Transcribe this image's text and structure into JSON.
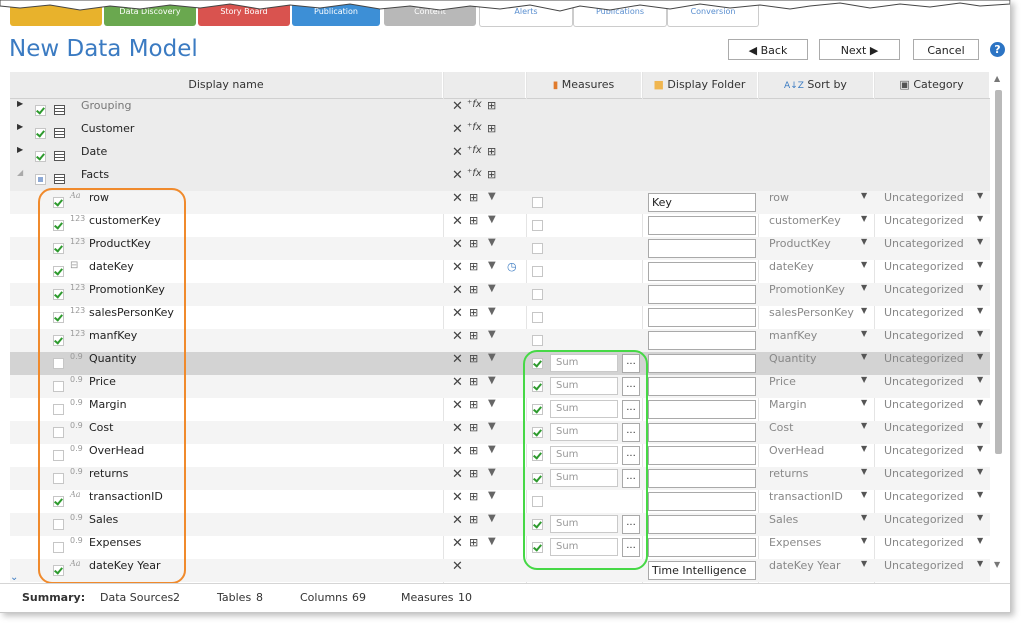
{
  "window": {
    "title": "New Data Model",
    "tabs": [
      "",
      "Data Discovery",
      "Story Board",
      "Publication",
      "Content",
      "Alerts",
      "Publications",
      "Conversion"
    ],
    "buttons": {
      "back": "Back",
      "next": "Next",
      "cancel": "Cancel",
      "help": "?"
    }
  },
  "columns": {
    "display_name": "Display name",
    "measures": "Measures",
    "display_folder": "Display Folder",
    "sort_by": "Sort by",
    "category": "Category"
  },
  "groups": [
    {
      "name": "Grouping",
      "checked": true
    },
    {
      "name": "Customer",
      "checked": true
    },
    {
      "name": "Date",
      "checked": true
    },
    {
      "name": "Facts",
      "checked": "partial"
    }
  ],
  "fields": [
    {
      "name": "row",
      "type": "Aa",
      "checked": true,
      "measure": false,
      "measure_box": true,
      "folder": "Key",
      "sort_by": "row",
      "category": "Uncategorized"
    },
    {
      "name": "customerKey",
      "type": "123",
      "checked": true,
      "measure": false,
      "measure_box": true,
      "folder": "",
      "sort_by": "customerKey",
      "category": "Uncategorized"
    },
    {
      "name": "ProductKey",
      "type": "123",
      "checked": true,
      "measure": false,
      "measure_box": true,
      "folder": "",
      "sort_by": "ProductKey",
      "category": "Uncategorized"
    },
    {
      "name": "dateKey",
      "type": "date",
      "checked": true,
      "measure": false,
      "measure_box": true,
      "folder": "",
      "sort_by": "dateKey",
      "category": "Uncategorized"
    },
    {
      "name": "PromotionKey",
      "type": "123",
      "checked": true,
      "measure": false,
      "measure_box": true,
      "folder": "",
      "sort_by": "PromotionKey",
      "category": "Uncategorized"
    },
    {
      "name": "salesPersonKey",
      "type": "123",
      "checked": true,
      "measure": false,
      "measure_box": true,
      "folder": "",
      "sort_by": "salesPersonKey",
      "category": "Uncategorized"
    },
    {
      "name": "manfKey",
      "type": "123",
      "checked": true,
      "measure": false,
      "measure_box": true,
      "folder": "",
      "sort_by": "manfKey",
      "category": "Uncategorized"
    },
    {
      "name": "Quantity",
      "type": "0.9",
      "checked": false,
      "measure": true,
      "agg": "Sum",
      "folder": "",
      "sort_by": "Quantity",
      "category": "Uncategorized",
      "selected": true
    },
    {
      "name": "Price",
      "type": "0.9",
      "checked": false,
      "measure": true,
      "agg": "Sum",
      "folder": "",
      "sort_by": "Price",
      "category": "Uncategorized"
    },
    {
      "name": "Margin",
      "type": "0.9",
      "checked": false,
      "measure": true,
      "agg": "Sum",
      "folder": "",
      "sort_by": "Margin",
      "category": "Uncategorized"
    },
    {
      "name": "Cost",
      "type": "0.9",
      "checked": false,
      "measure": true,
      "agg": "Sum",
      "folder": "",
      "sort_by": "Cost",
      "category": "Uncategorized"
    },
    {
      "name": "OverHead",
      "type": "0.9",
      "checked": false,
      "measure": true,
      "agg": "Sum",
      "folder": "",
      "sort_by": "OverHead",
      "category": "Uncategorized"
    },
    {
      "name": "returns",
      "type": "0.9",
      "checked": false,
      "measure": true,
      "agg": "Sum",
      "folder": "",
      "sort_by": "returns",
      "category": "Uncategorized"
    },
    {
      "name": "transactionID",
      "type": "Aa",
      "checked": true,
      "measure": false,
      "measure_box": true,
      "folder": "",
      "sort_by": "transactionID",
      "category": "Uncategorized"
    },
    {
      "name": "Sales",
      "type": "0.9",
      "checked": false,
      "measure": true,
      "agg": "Sum",
      "folder": "",
      "sort_by": "Sales",
      "category": "Uncategorized"
    },
    {
      "name": "Expenses",
      "type": "0.9",
      "checked": false,
      "measure": true,
      "agg": "Sum",
      "folder": "",
      "sort_by": "Expenses",
      "category": "Uncategorized"
    },
    {
      "name": "dateKey Year",
      "type": "Aa",
      "checked": true,
      "measure": false,
      "measure_box": false,
      "folder": "Time Intelligence",
      "sort_by": "dateKey Year",
      "category": "Uncategorized"
    }
  ],
  "summary": {
    "label": "Summary:",
    "data_sources_label": "Data Sources",
    "data_sources": "2",
    "tables_label": "Tables",
    "tables": "8",
    "columns_label": "Columns",
    "columns": "69",
    "measures_label": "Measures",
    "measures": "10"
  },
  "colors": {
    "accent": "#3b7bc2",
    "orange_highlight": "#f08a2c",
    "green_highlight": "#46d846",
    "check": "#2e9a2e"
  }
}
